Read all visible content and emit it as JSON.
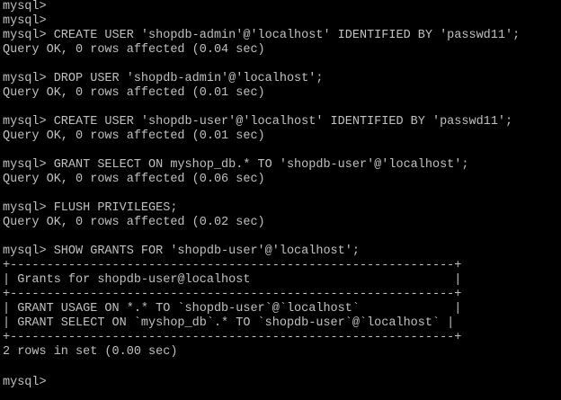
{
  "terminal": {
    "lines": [
      "mysql>",
      "mysql>",
      "mysql> CREATE USER 'shopdb-admin'@'localhost' IDENTIFIED BY 'passwd11';",
      "Query OK, 0 rows affected (0.04 sec)",
      "",
      "mysql> DROP USER 'shopdb-admin'@'localhost';",
      "Query OK, 0 rows affected (0.01 sec)",
      "",
      "mysql> CREATE USER 'shopdb-user'@'localhost' IDENTIFIED BY 'passwd11';",
      "Query OK, 0 rows affected (0.01 sec)",
      "",
      "mysql> GRANT SELECT ON myshop_db.* TO 'shopdb-user'@'localhost';",
      "Query OK, 0 rows affected (0.06 sec)",
      "",
      "mysql> FLUSH PRIVILEGES;",
      "Query OK, 0 rows affected (0.02 sec)",
      "",
      "mysql> SHOW GRANTS FOR 'shopdb-user'@'localhost';",
      "+-------------------------------------------------------------+",
      "| Grants for shopdb-user@localhost                            |",
      "+-------------------------------------------------------------+",
      "| GRANT USAGE ON *.* TO `shopdb-user`@`localhost`             |",
      "| GRANT SELECT ON `myshop_db`.* TO `shopdb-user`@`localhost` |",
      "+-------------------------------------------------------------+",
      "2 rows in set (0.00 sec)",
      "",
      "mysql>"
    ]
  },
  "colors": {
    "background": "#000000",
    "foreground": "#c0c0c0"
  }
}
